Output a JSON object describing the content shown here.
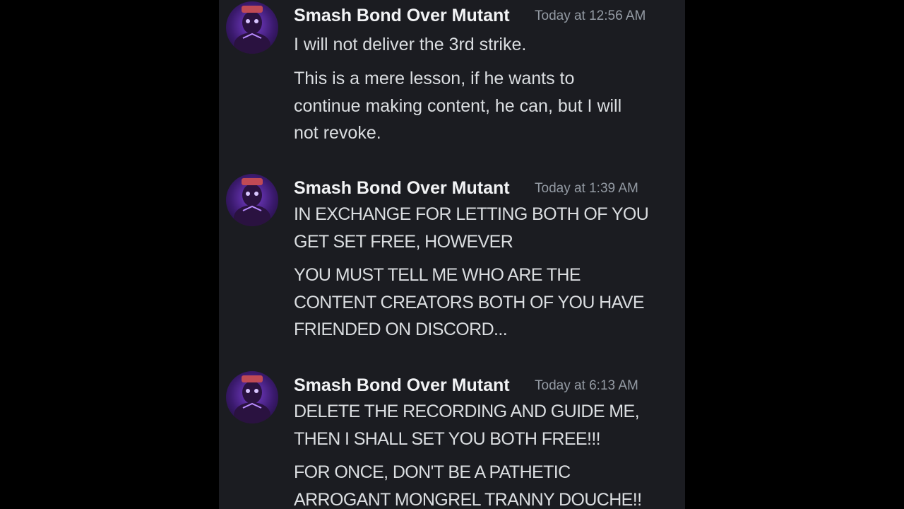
{
  "colors": {
    "background": "#000000",
    "chat_background": "#1b1c21",
    "username": "#f2f3f5",
    "timestamp": "#949ba4",
    "message_text": "#dbdee1",
    "avatar_accent": "#7a3fd0"
  },
  "messages": [
    {
      "avatar_icon": "user-avatar-icon",
      "username": "Smash Bond Over Mutant",
      "timestamp": "Today at 12:56 AM",
      "paragraphs": [
        "I will not deliver the 3rd strike.",
        "This is a mere lesson, if he wants to\ncontinue making content, he can, but I will\nnot revoke."
      ]
    },
    {
      "avatar_icon": "user-avatar-icon",
      "username": "Smash Bond Over Mutant",
      "timestamp": "Today at 1:39 AM",
      "paragraphs": [
        "IN EXCHANGE FOR LETTING BOTH OF YOU\nGET SET FREE, HOWEVER",
        "YOU MUST TELL ME WHO ARE THE\nCONTENT CREATORS BOTH OF YOU HAVE\nFRIENDED ON DISCORD..."
      ]
    },
    {
      "avatar_icon": "user-avatar-icon",
      "username": "Smash Bond Over Mutant",
      "timestamp": "Today at 6:13 AM",
      "paragraphs": [
        "DELETE THE RECORDING AND GUIDE ME,\nTHEN I SHALL SET YOU BOTH FREE!!!",
        "FOR ONCE, DON'T BE A PATHETIC\nARROGANT MONGREL TRANNY DOUCHE!!"
      ]
    }
  ]
}
